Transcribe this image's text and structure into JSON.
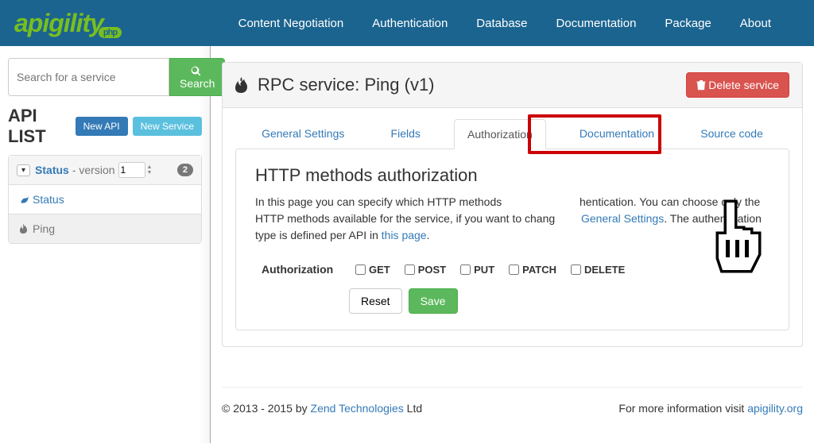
{
  "nav": {
    "brand": "apigility",
    "brand_pill": "php",
    "links": [
      "Content Negotiation",
      "Authentication",
      "Database",
      "Documentation",
      "Package",
      "About"
    ]
  },
  "search": {
    "placeholder": "Search for a service",
    "button": "Search"
  },
  "apilist": {
    "title": "API LIST",
    "new_api": "New API",
    "new_service": "New Service",
    "api_name": "Status",
    "version_label": "- version",
    "version_value": "1",
    "count": "2",
    "items": [
      {
        "name": "Status",
        "active": false
      },
      {
        "name": "Ping",
        "active": true
      }
    ]
  },
  "service": {
    "title": "RPC service: Ping (v1)",
    "delete_label": "Delete service",
    "tabs": [
      "General Settings",
      "Fields",
      "Authorization",
      "Documentation",
      "Source code"
    ],
    "active_tab": 2
  },
  "authorization": {
    "heading": "HTTP methods authorization",
    "desc_1": "In this page you can specify which HTTP methods",
    "desc_2": "hentication. You can choose only the HTTP methods available for the service, if you want to chang",
    "link_general": "General Settings",
    "desc_3": ". The authentication type is defined per API in ",
    "link_this_page": "this page",
    "label": "Authorization",
    "methods": [
      "GET",
      "POST",
      "PUT",
      "PATCH",
      "DELETE"
    ],
    "reset": "Reset",
    "save": "Save"
  },
  "footer": {
    "copyright_prefix": "© 2013 - 2015 by ",
    "copyright_link": "Zend Technologies",
    "copyright_suffix": " Ltd",
    "info_prefix": "For more information visit ",
    "info_link": "apigility.org"
  }
}
